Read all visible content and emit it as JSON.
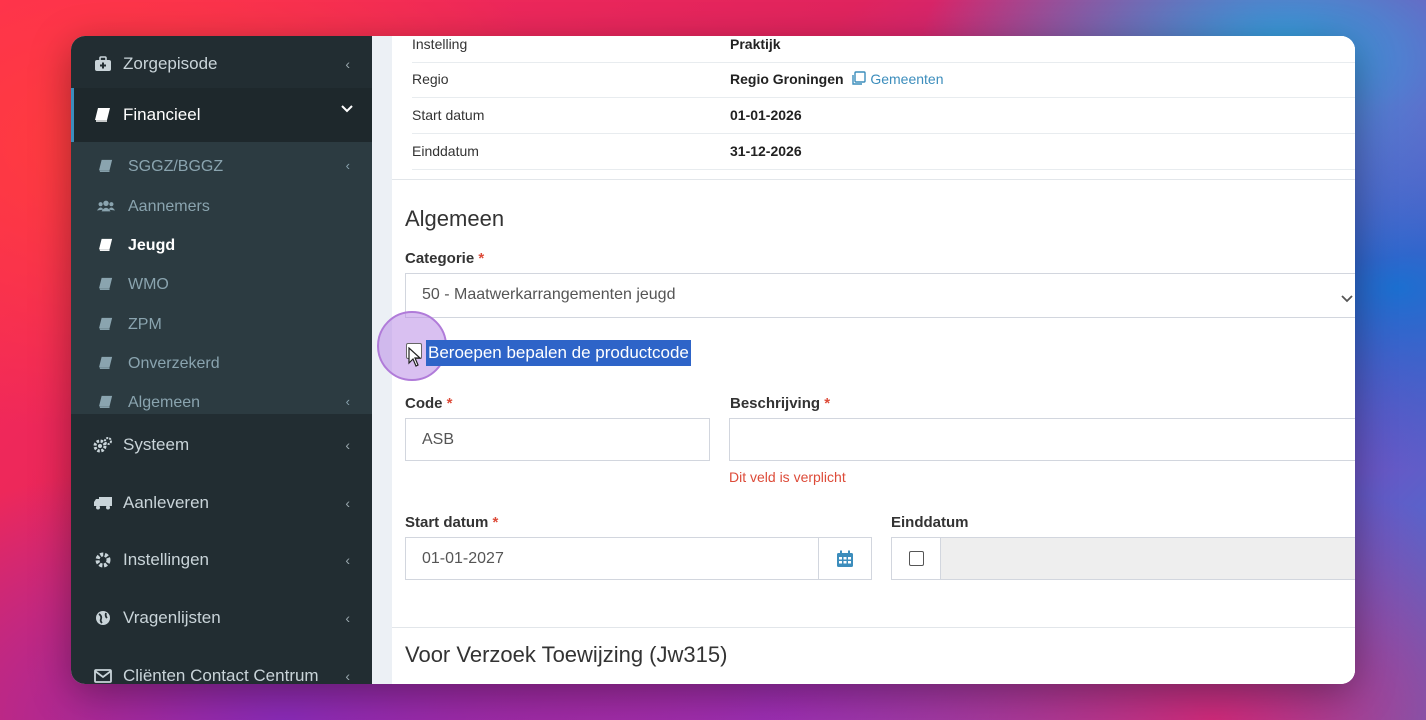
{
  "sidebar": {
    "items": [
      {
        "label": "Zorgepisode",
        "icon": "medkit-icon",
        "chevron": "‹"
      },
      {
        "label": "Financieel",
        "icon": "book-icon",
        "chevron": "⌄"
      },
      {
        "label": "Systeem",
        "icon": "cogs-icon",
        "chevron": "‹"
      },
      {
        "label": "Aanleveren",
        "icon": "truck-icon",
        "chevron": "‹"
      },
      {
        "label": "Instellingen",
        "icon": "gear-icon",
        "chevron": "‹"
      },
      {
        "label": "Vragenlijsten",
        "icon": "globe-icon",
        "chevron": "‹"
      },
      {
        "label": "Cliënten Contact Centrum",
        "icon": "envelope-icon",
        "chevron": "‹"
      }
    ],
    "submenu": [
      {
        "label": "SGGZ/BGGZ",
        "icon": "book-icon",
        "chevron": "‹"
      },
      {
        "label": "Aannemers",
        "icon": "users-icon",
        "chevron": ""
      },
      {
        "label": "Jeugd",
        "icon": "book-icon",
        "chevron": ""
      },
      {
        "label": "WMO",
        "icon": "book-icon",
        "chevron": ""
      },
      {
        "label": "ZPM",
        "icon": "book-icon",
        "chevron": ""
      },
      {
        "label": "Onverzekerd",
        "icon": "book-icon",
        "chevron": ""
      },
      {
        "label": "Algemeen",
        "icon": "book-icon",
        "chevron": "‹"
      }
    ]
  },
  "info": {
    "rows": [
      {
        "key": "Instelling",
        "value": "Praktijk"
      },
      {
        "key": "Regio",
        "value": "Regio Groningen",
        "link": "Gemeenten"
      },
      {
        "key": "Start datum",
        "value": "01-01-2026"
      },
      {
        "key": "Einddatum",
        "value": "31-12-2026"
      }
    ]
  },
  "form": {
    "section_title": "Algemeen",
    "categorie_label": "Categorie",
    "required_mark": "*",
    "categorie_value": "50 - Maatwerkarrangementen jeugd",
    "checkbox_label": "Beroepen bepalen de productcode",
    "code_label": "Code",
    "code_value": "ASB",
    "beschrijving_label": "Beschrijving",
    "beschrijving_value": "",
    "beschrijving_error": "Dit veld is verplicht",
    "start_label": "Start datum",
    "start_value": "01-01-2027",
    "eind_label": "Einddatum",
    "next_section_title": "Voor Verzoek Toewijzing (Jw315)"
  },
  "colors": {
    "accent": "#3c8dbc",
    "error": "#dd4b39",
    "selection": "#2e64c8",
    "sidebar": "#222d32"
  }
}
